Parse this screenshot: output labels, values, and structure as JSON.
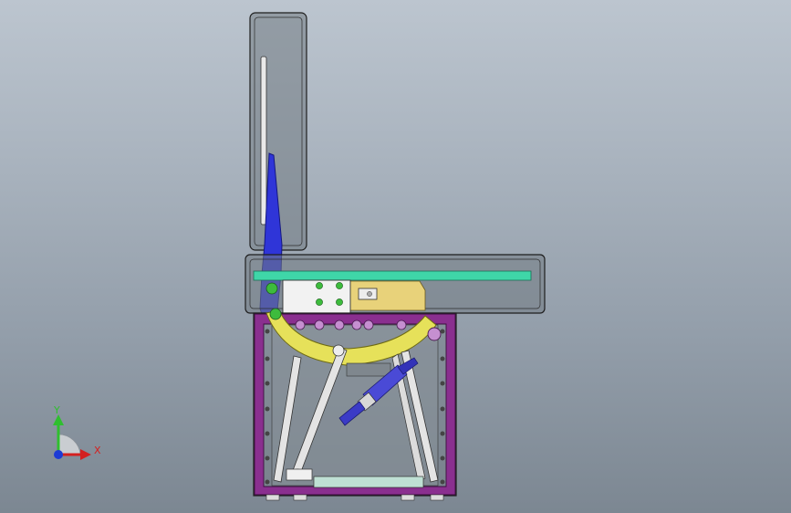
{
  "viewport": {
    "background_top": "#bcc5cf",
    "background_bottom": "#7c8792"
  },
  "model": {
    "colors": {
      "housing_fill": "#6d757d",
      "housing_edge": "#1e1e1e",
      "rail": "#3fd6a8",
      "arm": "#2f35d8",
      "ring": "#e6e15a",
      "frame": "#8a2f8f",
      "pivot": "#3dbb3d",
      "block": "#f2f2f2",
      "cylinder": "#4a4ad6"
    }
  },
  "triad": {
    "x_label": "X",
    "y_label": "Y",
    "x_color": "#d42020",
    "y_color": "#2fbf2f",
    "z_color": "#1d3bd6"
  }
}
